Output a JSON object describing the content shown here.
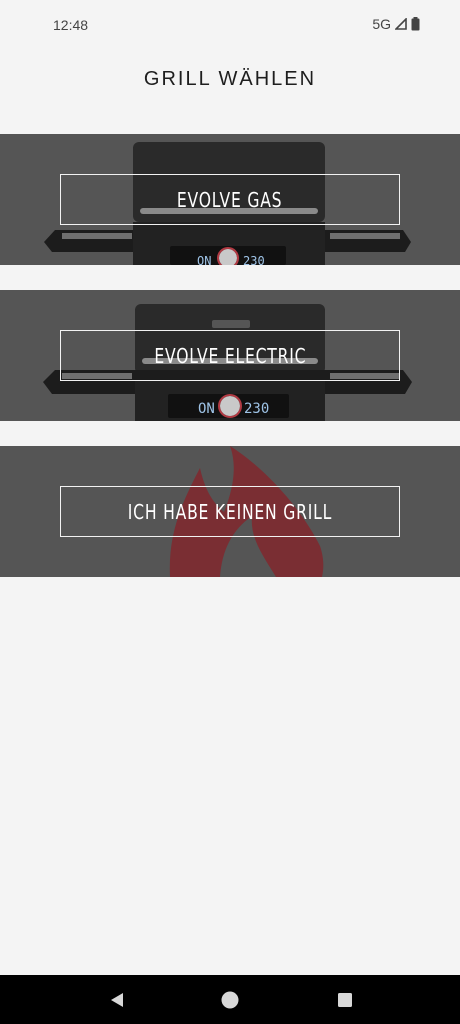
{
  "status_bar": {
    "time": "12:48",
    "network": "5G",
    "icons": [
      "signal-icon",
      "battery-icon"
    ]
  },
  "header": {
    "title": "GRILL WÄHLEN"
  },
  "options": [
    {
      "label": "EVOLVE GAS",
      "display_left": "ON",
      "display_right": "230"
    },
    {
      "label": "EVOLVE ELECTRIC",
      "display_left": "ON",
      "display_right": "230"
    },
    {
      "label": "ICH HABE KEINEN GRILL"
    }
  ],
  "nav": {
    "icons": [
      "back-icon",
      "home-icon",
      "recents-icon"
    ]
  },
  "colors": {
    "background": "#f4f4f4",
    "card": "#555555",
    "grill": "#1c1c1c",
    "flame": "#7a2e33",
    "nav": "#000000"
  }
}
